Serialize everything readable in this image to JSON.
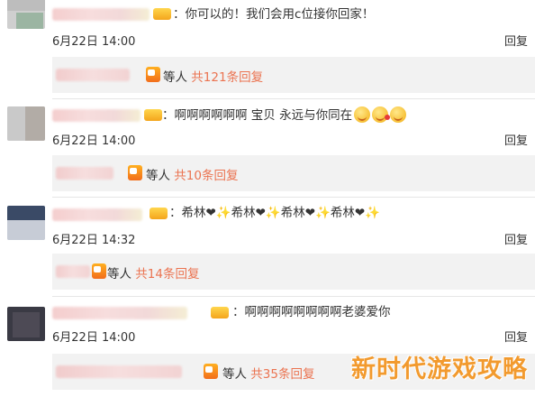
{
  "comments": [
    {
      "text": "：你可以的！我们会用c位接你回家！",
      "emoji": [],
      "date": "6月22日 14:00",
      "reply_label": "回复",
      "replies": {
        "others": "等人",
        "count": "共121条回复"
      }
    },
    {
      "text": "：啊啊啊啊啊啊 宝贝 永远与你同在",
      "emoji": [
        "smiling-face-icon",
        "kiss-face-icon",
        "smiling-face-icon"
      ],
      "date": "6月22日 14:00",
      "reply_label": "回复",
      "replies": {
        "others": "等人",
        "count": "共10条回复"
      }
    },
    {
      "text": "：希林❤✨希林❤✨希林❤✨希林❤✨",
      "emoji": [],
      "date": "6月22日 14:32",
      "reply_label": "回复",
      "replies": {
        "others": "等人",
        "count": "共14条回复"
      }
    },
    {
      "text": "：啊啊啊啊啊啊啊啊老婆爱你",
      "emoji": [],
      "date": "6月22日 14:00",
      "reply_label": "回复",
      "replies": {
        "others": "等人",
        "count": "共35条回复"
      }
    }
  ],
  "watermark": "新时代游戏攻略",
  "colors": {
    "reply_count": "#eb7350",
    "reply_box": "#f2f2f2",
    "watermark": "#f29a2e"
  }
}
